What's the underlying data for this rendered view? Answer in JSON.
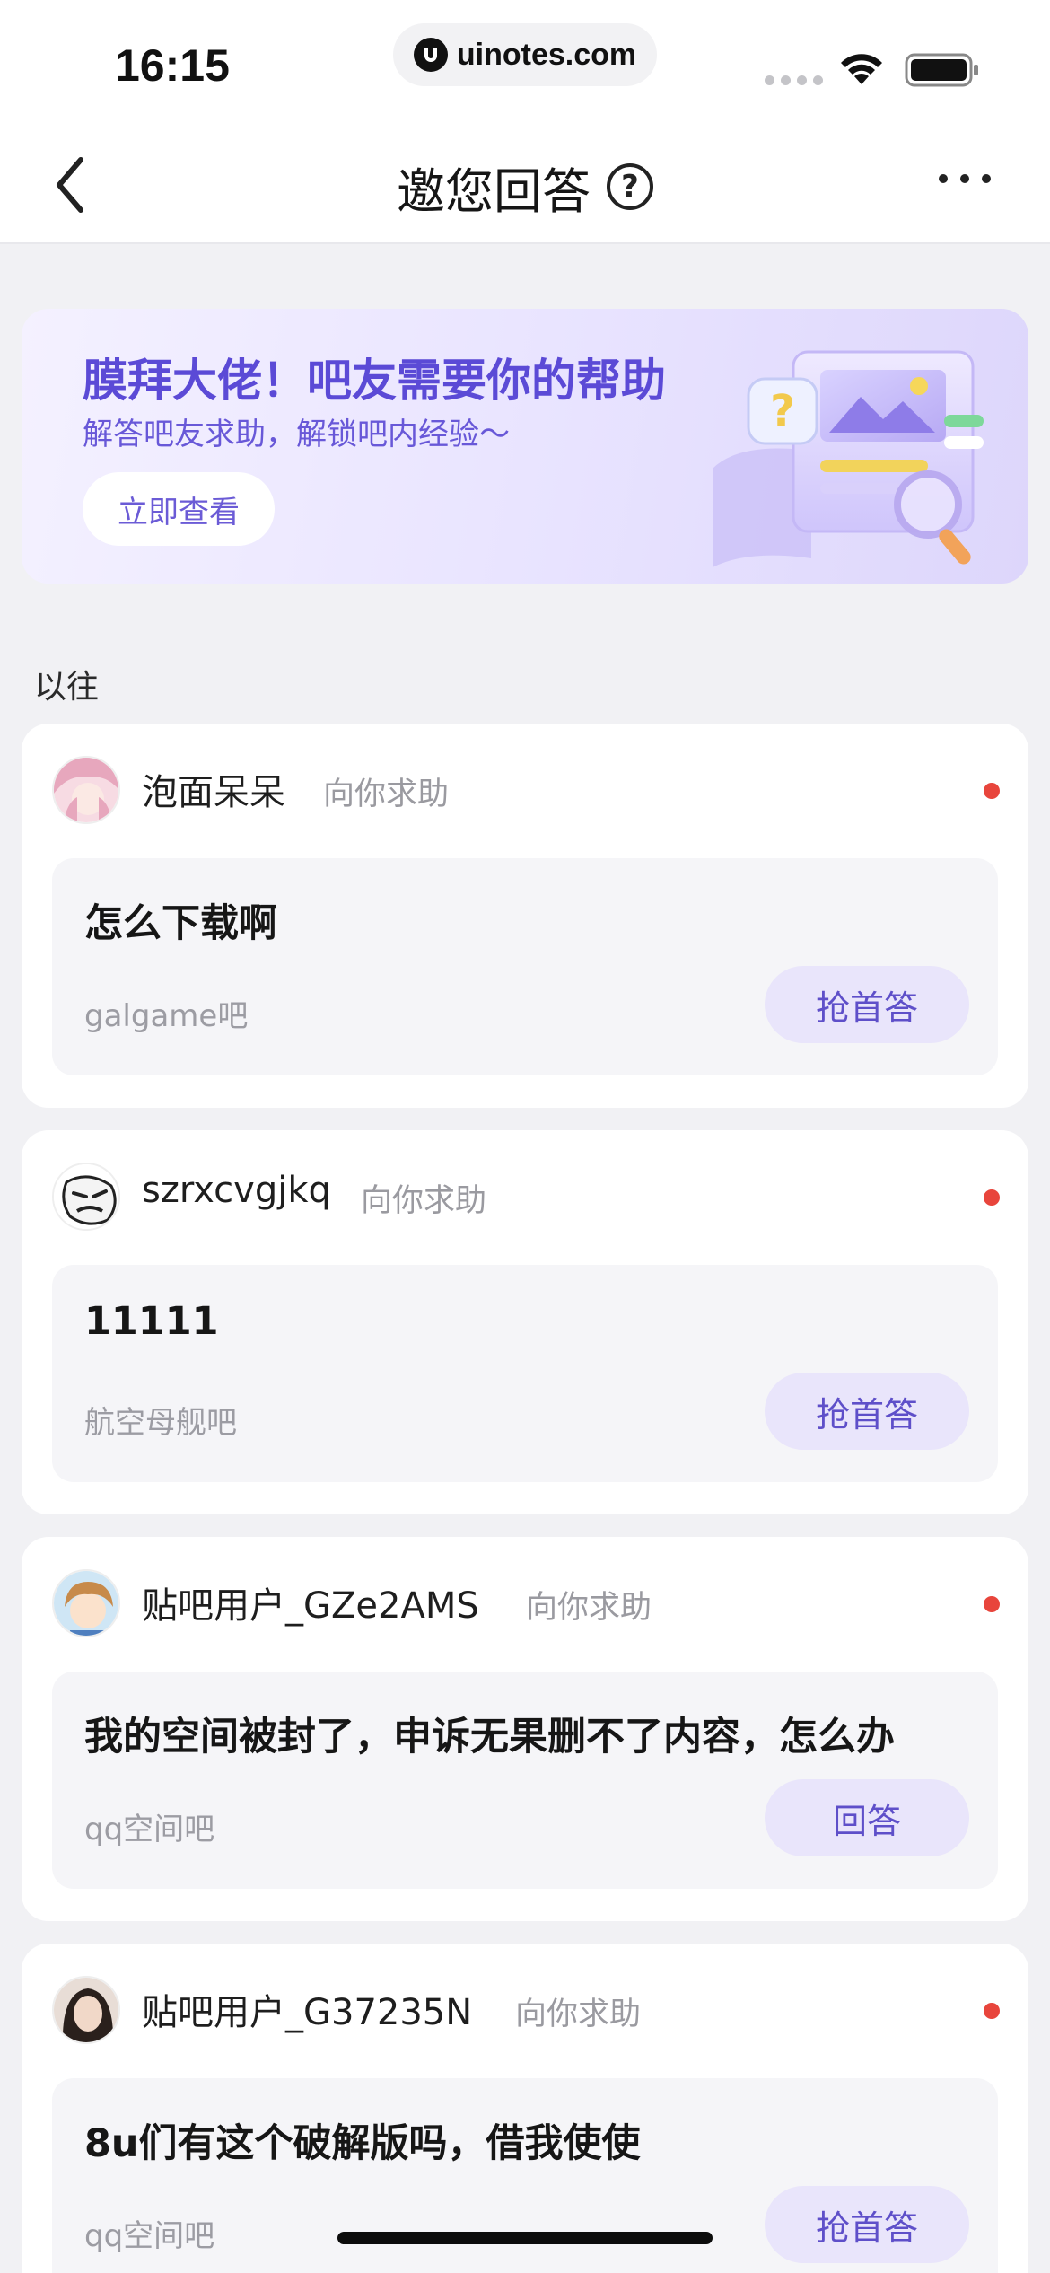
{
  "status_bar": {
    "time": "16:15",
    "url": "uinotes.com"
  },
  "nav": {
    "title": "邀您回答",
    "help_glyph": "?"
  },
  "banner": {
    "title": "膜拜大佬！吧友需要你的帮助",
    "subtitle": "解答吧友求助，解锁吧内经验～",
    "button_label": "立即查看"
  },
  "section_label": "以往",
  "colors": {
    "accent": "#5b4ad6",
    "unread_dot": "#e8453c",
    "button_bg": "#e9e5fb"
  },
  "cards": [
    {
      "user": "泡面呆呆",
      "action": "向你求助",
      "question": "怎么下载啊",
      "forum": "galgame吧",
      "button": "抢首答",
      "avatar_icon": "anime-girl-avatar"
    },
    {
      "user": "szrxcvgjkq",
      "action": "向你求助",
      "question": "11111",
      "forum": "航空母舰吧",
      "button": "抢首答",
      "avatar_icon": "meme-face-avatar"
    },
    {
      "user": "贴吧用户_GZe2AMS",
      "action": "向你求助",
      "question": "我的空间被封了，申诉无果删不了内容，怎么办",
      "forum": "qq空间吧",
      "button": "回答",
      "avatar_icon": "anime-boy-avatar"
    },
    {
      "user": "贴吧用户_G37235N",
      "action": "向你求助",
      "question": "8u们有这个破解版吗，借我使使",
      "forum": "qq空间吧",
      "button": "抢首答",
      "avatar_icon": "photo-avatar"
    }
  ]
}
